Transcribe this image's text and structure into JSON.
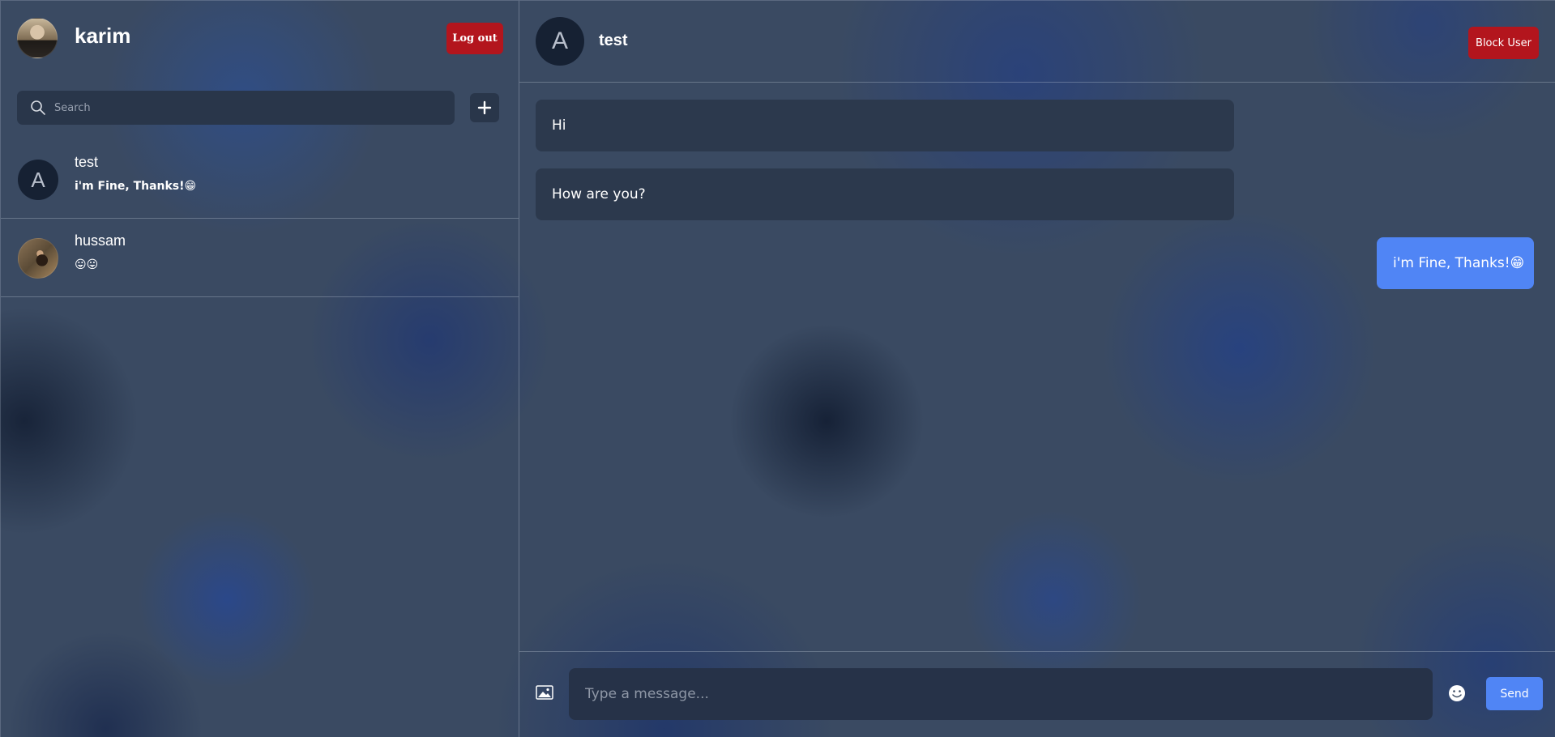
{
  "current_user": {
    "name": "karim",
    "logout_label": "Log out"
  },
  "search": {
    "placeholder": "Search"
  },
  "chats": [
    {
      "avatar_letter": "A",
      "name": "test",
      "last_message": "i'm Fine, Thanks!😁"
    },
    {
      "name": "hussam",
      "last_message": "😛😛"
    }
  ],
  "active_chat": {
    "avatar_letter": "A",
    "name": "test",
    "block_label": "Block User",
    "messages": [
      {
        "text": "Hi",
        "direction": "incoming"
      },
      {
        "text": "How are you?",
        "direction": "incoming"
      },
      {
        "text": "i'm Fine, Thanks!😁",
        "direction": "outgoing"
      }
    ]
  },
  "composer": {
    "placeholder": "Type a message...",
    "send_label": "Send"
  },
  "colors": {
    "accent": "#5085f5",
    "danger": "#b3151d",
    "panel": "#29364a"
  }
}
